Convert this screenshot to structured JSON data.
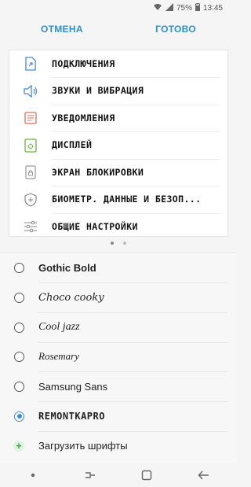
{
  "status_bar": {
    "battery_percent": "75%",
    "time": "13:45"
  },
  "top_bar": {
    "cancel_label": "ОТМЕНА",
    "done_label": "ГОТОВО",
    "accent_color": "#2e8ecf"
  },
  "preview": {
    "items": [
      {
        "label": "ПОДКЛЮЧЕНИЯ",
        "icon": "connections-icon"
      },
      {
        "label": "ЗВУКИ И ВИБРАЦИЯ",
        "icon": "sound-icon"
      },
      {
        "label": "УВЕДОМЛЕНИЯ",
        "icon": "notifications-icon"
      },
      {
        "label": "ДИСПЛЕЙ",
        "icon": "display-icon"
      },
      {
        "label": "ЭКРАН БЛОКИРОВКИ",
        "icon": "lock-screen-icon"
      },
      {
        "label": "БИОМЕТР. ДАННЫЕ И БЕЗОП...",
        "icon": "shield-icon"
      },
      {
        "label": "ОБЩИЕ НАСТРОЙКИ",
        "icon": "sliders-icon"
      }
    ],
    "page_indicator": {
      "pages": 2,
      "active": 1
    }
  },
  "fonts": {
    "options": [
      {
        "label": "Gothic Bold",
        "selected": false
      },
      {
        "label": "Choco cooky",
        "selected": false
      },
      {
        "label": "Cool jazz",
        "selected": false
      },
      {
        "label": "Rosemary",
        "selected": false
      },
      {
        "label": "Samsung Sans",
        "selected": false
      },
      {
        "label": "REMONTKAPRO",
        "selected": true
      }
    ],
    "download_label": "Загрузить шрифты"
  }
}
